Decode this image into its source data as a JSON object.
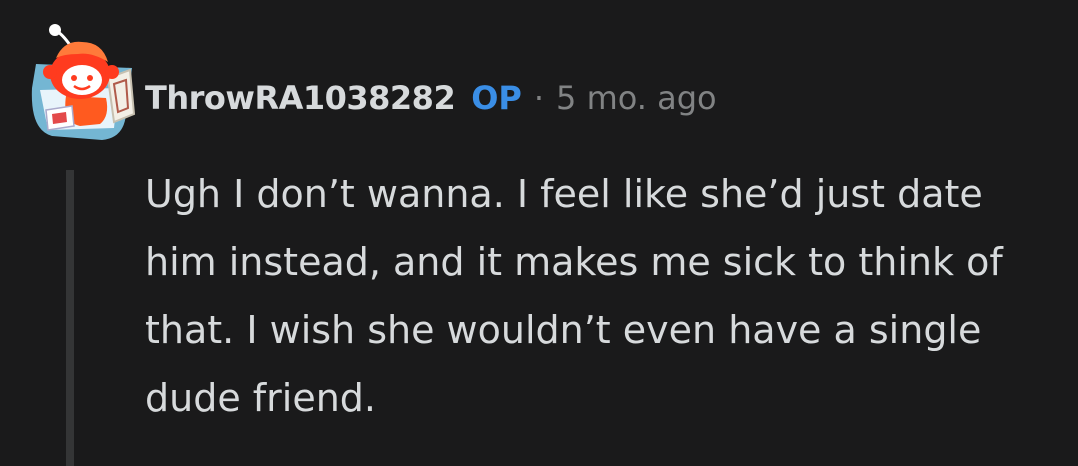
{
  "comment": {
    "avatar_icon": "snoo-avatar-icon",
    "username": "ThrowRA1038282",
    "op_badge": "OP",
    "separator": "·",
    "timestamp": "5 mo. ago",
    "body": "Ugh I don’t wanna. I feel like she’d just date him instead, and it makes me sick to think of that. I wish she wouldn’t even have a single dude friend."
  },
  "colors": {
    "background": "#1a1a1b",
    "text": "#d7dadc",
    "op_badge": "#3a8ee6",
    "muted": "#818384",
    "thread_line": "#343536"
  }
}
